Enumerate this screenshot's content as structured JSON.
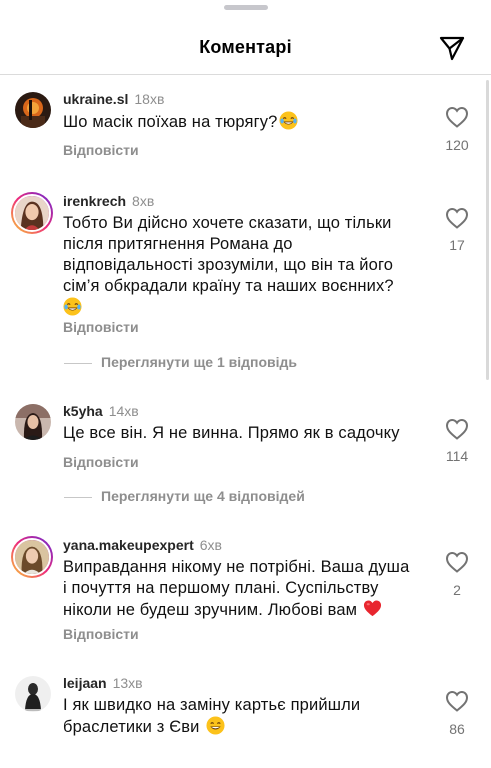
{
  "header": {
    "title": "Коментарі",
    "share_icon": "paper-plane-icon"
  },
  "comments": [
    {
      "username": "ukraine.sl",
      "time": "18хв",
      "lines": [
        "Шо масік поїхав на тюрягу?"
      ],
      "emoji": "face-with-tears-of-joy",
      "reply_label": "Відповісти",
      "likes": "120"
    },
    {
      "username": "irenkrech",
      "time": "8хв",
      "lines": [
        "Тобто Ви дійсно хочете сказати, що тільки",
        "після притягнення Романа до",
        "відповідальності зрозуміли, що він та його",
        "сім’я обкрадали країну та наших воєнних?"
      ],
      "emoji": "face-with-tears-of-joy",
      "reply_label": "Відповісти",
      "likes": "17",
      "view_replies": "Переглянути ще 1 відповідь"
    },
    {
      "username": "k5yha",
      "time": "14хв",
      "lines": [
        "Це все він. Я не винна. Прямо як в садочку"
      ],
      "reply_label": "Відповісти",
      "likes": "114",
      "view_replies": "Переглянути ще 4 відповідей"
    },
    {
      "username": "yana.makeupexpert",
      "time": "6хв",
      "lines": [
        "Виправдання нікому не потрібні. Ваша душа",
        "і почуття на першому плані. Суспільству",
        "ніколи не будеш зручним. Любові вам"
      ],
      "emoji": "red-heart",
      "reply_label": "Відповісти",
      "likes": "2"
    },
    {
      "username": "leijaan",
      "time": "13хв",
      "lines": [
        "І як швидко на заміну картьє прийшли",
        "браслетики з Єви"
      ],
      "emoji": "grinning-face-with-smiling-eyes",
      "likes": "86"
    }
  ],
  "colors": {
    "text": "#111111",
    "secondary": "#8e8e8e",
    "story_ring_start": "#f9ce34",
    "story_ring_mid": "#ee2a7b",
    "story_ring_end": "#6228d7",
    "heart_emoji": "#e8262f"
  }
}
